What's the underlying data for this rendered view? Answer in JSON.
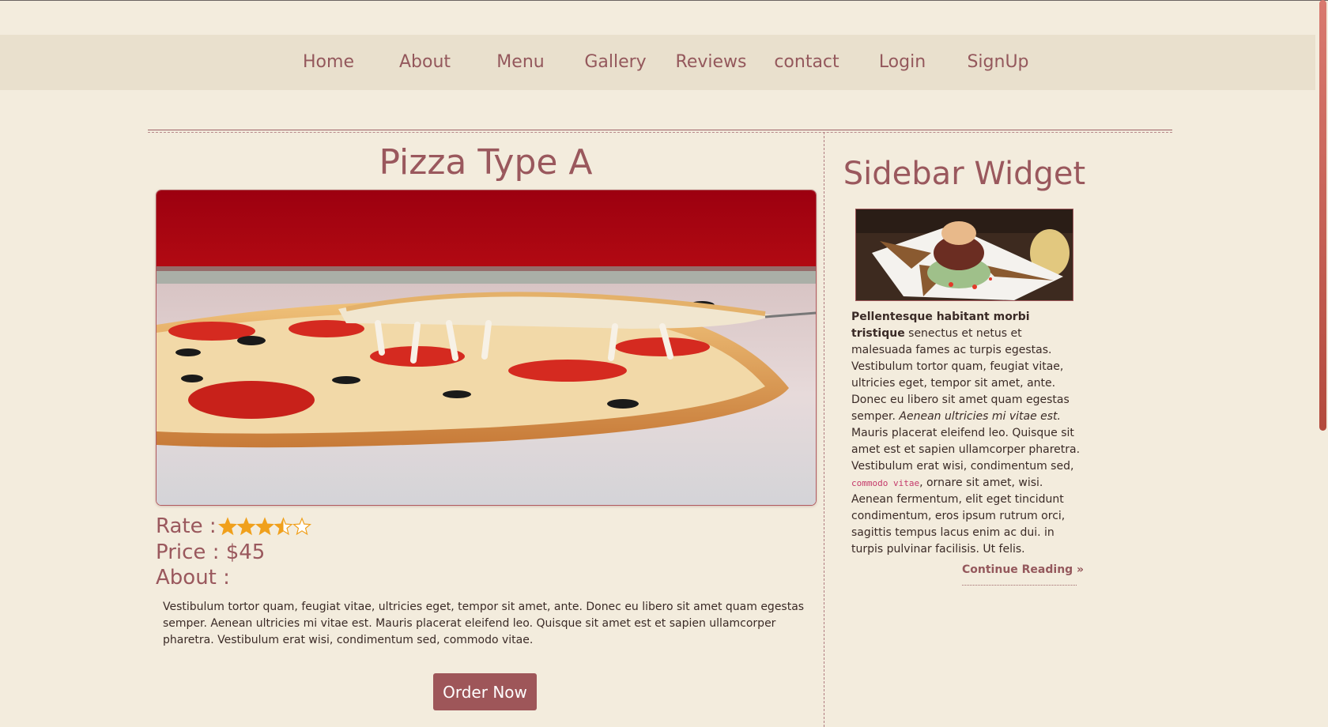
{
  "nav": {
    "items": [
      {
        "label": "Home"
      },
      {
        "label": "About"
      },
      {
        "label": "Menu"
      },
      {
        "label": "Gallery"
      },
      {
        "label": "Reviews"
      },
      {
        "label": "contact"
      },
      {
        "label": "Login"
      },
      {
        "label": "SignUp"
      }
    ]
  },
  "product": {
    "title": "Pizza Type A",
    "rate_label": "Rate :",
    "rating": 3.5,
    "rating_max": 5,
    "price_label": "Price : $45",
    "about_label": "About :",
    "about_text": "Vestibulum tortor quam, feugiat vitae, ultricies eget, tempor sit amet, ante. Donec eu libero sit amet quam egestas semper. Aenean ultricies mi vitae est. Mauris placerat eleifend leo. Quisque sit amet est et sapien ullamcorper pharetra. Vestibulum erat wisi, condimentum sed, commodo vitae.",
    "order_button": "Order Now"
  },
  "sidebar": {
    "title": "Sidebar Widget",
    "text_bold": "Pellentesque habitant morbi tristique",
    "text_part1": " senectus et netus et malesuada fames ac turpis egestas. Vestibulum tortor quam, feugiat vitae, ultricies eget, tempor sit amet, ante. Donec eu libero sit amet quam egestas semper. ",
    "text_italic": "Aenean ultricies mi vitae est.",
    "text_part2": " Mauris placerat eleifend leo. Quisque sit amet est et sapien ullamcorper pharetra. Vestibulum erat wisi, condimentum sed, ",
    "text_code": "commodo vitae",
    "text_part3": ", ornare sit amet, wisi. Aenean fermentum, elit eget tincidunt condimentum, eros ipsum rutrum orci, sagittis tempus lacus enim ac dui. in turpis pulvinar facilisis. Ut felis.",
    "continue_label": "Continue Reading »"
  },
  "colors": {
    "accent": "#9a585d",
    "background": "#f3ecdd",
    "star": "#f0a01c"
  }
}
